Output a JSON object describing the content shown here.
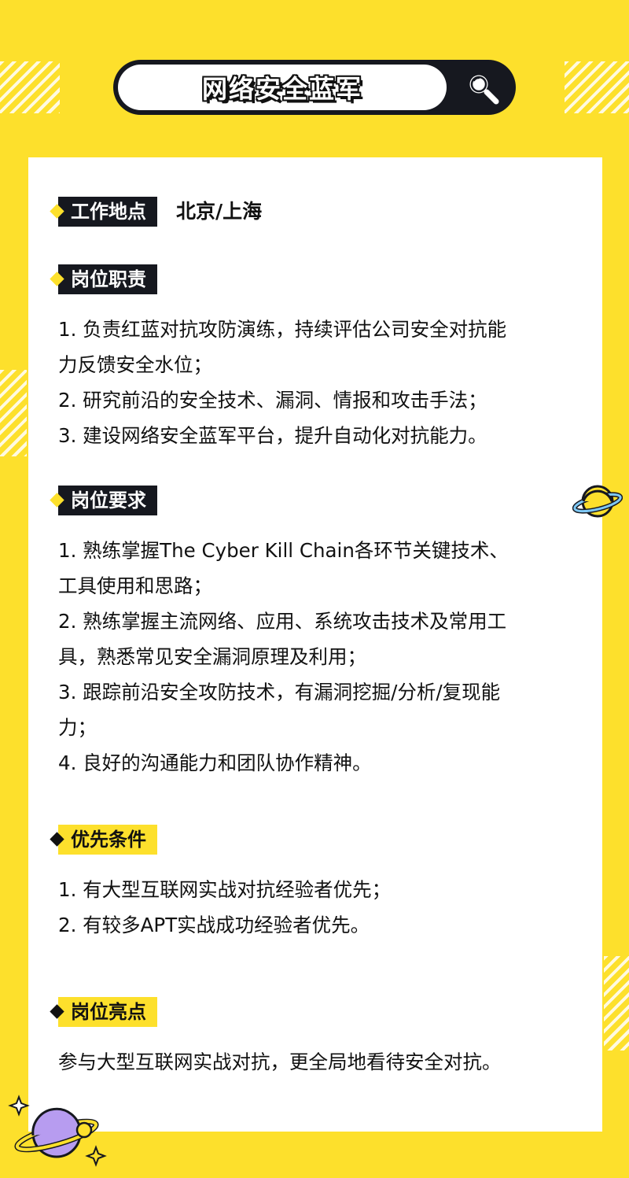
{
  "header": {
    "title": "网络安全蓝军"
  },
  "location": {
    "label": "工作地点",
    "value": "北京/上海"
  },
  "duties": {
    "label": "岗位职责",
    "lines": [
      "1. 负责红蓝对抗攻防演练，持续评估公司安全对抗能",
      "力反馈安全水位；",
      "2. 研究前沿的安全技术、漏洞、情报和攻击手法；",
      "3. 建设网络安全蓝军平台，提升自动化对抗能力。"
    ]
  },
  "requirements": {
    "label": "岗位要求",
    "lines": [
      "1. 熟练掌握The Cyber Kill Chain各环节关键技术、",
      "工具使用和思路；",
      "2. 熟练掌握主流网络、应用、系统攻击技术及常用工",
      "具，熟悉常见安全漏洞原理及利用；",
      "3. 跟踪前沿安全攻防技术，有漏洞挖掘/分析/复现能",
      "力；",
      "4. 良好的沟通能力和团队协作精神。"
    ]
  },
  "preferred": {
    "label": "优先条件",
    "lines": [
      "1. 有大型互联网实战对抗经验者优先；",
      "2. 有较多APT实战成功经验者优先。"
    ]
  },
  "highlights": {
    "label": "岗位亮点",
    "lines": [
      "参与大型互联网实战对抗，更全局地看待安全对抗。"
    ]
  },
  "icons": {
    "search": "magnifier-icon",
    "planet_yellow": "planet-icon",
    "planet_purple": "planet-icon",
    "sparkle": "sparkle-icon"
  },
  "colors": {
    "background": "#FDE02C",
    "dark": "#16181f",
    "card": "#FFFFFF"
  }
}
